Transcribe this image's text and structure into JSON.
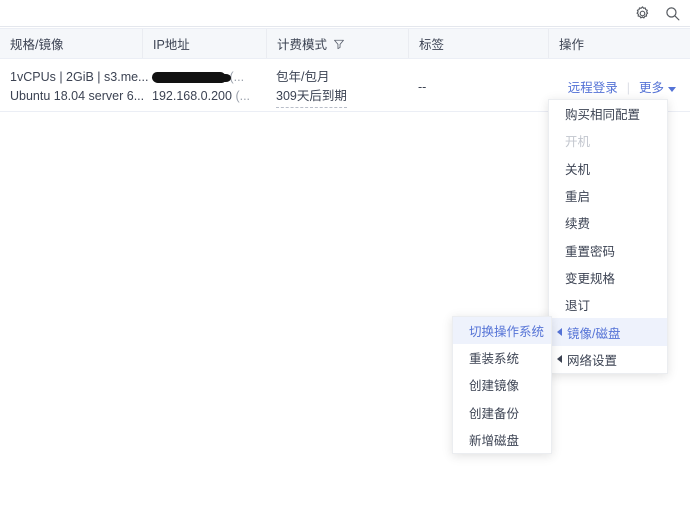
{
  "toolbar": {
    "icons": [
      {
        "name": "gear-icon",
        "label": "设置"
      },
      {
        "name": "search-icon",
        "label": "搜索"
      }
    ]
  },
  "table": {
    "headers": [
      {
        "label": "规格/镜像",
        "filter": false
      },
      {
        "label": "IP地址",
        "filter": false
      },
      {
        "label": "计费模式",
        "filter": true
      },
      {
        "label": "标签",
        "filter": false
      },
      {
        "label": "操作",
        "filter": false
      }
    ],
    "rows": [
      {
        "spec_line1": "1vCPUs | 2GiB | s3.me...",
        "spec_line2": "Ubuntu 18.04 server 6...",
        "ip_line1_tail": "(...",
        "ip_line2": "192.168.0.200",
        "ip_line2_tail": "(...",
        "billing_line1": "包年/包月",
        "billing_line2": "309天后到期",
        "tag": "--",
        "action_login": "远程登录",
        "action_more": "更多"
      }
    ]
  },
  "menu": {
    "items": [
      {
        "label": "购买相同配置",
        "disabled": false,
        "active": false,
        "submenu": false
      },
      {
        "label": "开机",
        "disabled": true,
        "active": false,
        "submenu": false
      },
      {
        "label": "关机",
        "disabled": false,
        "active": false,
        "submenu": false
      },
      {
        "label": "重启",
        "disabled": false,
        "active": false,
        "submenu": false
      },
      {
        "label": "续费",
        "disabled": false,
        "active": false,
        "submenu": false
      },
      {
        "label": "重置密码",
        "disabled": false,
        "active": false,
        "submenu": false
      },
      {
        "label": "变更规格",
        "disabled": false,
        "active": false,
        "submenu": false
      },
      {
        "label": "退订",
        "disabled": false,
        "active": false,
        "submenu": false
      },
      {
        "label": "镜像/磁盘",
        "disabled": false,
        "active": true,
        "submenu": true
      },
      {
        "label": "网络设置",
        "disabled": false,
        "active": false,
        "submenu": true
      }
    ]
  },
  "submenu": {
    "items": [
      {
        "label": "切换操作系统",
        "active": true
      },
      {
        "label": "重装系统",
        "active": false
      },
      {
        "label": "创建镜像",
        "active": false
      },
      {
        "label": "创建备份",
        "active": false
      },
      {
        "label": "新增磁盘",
        "active": false
      }
    ]
  },
  "colors": {
    "link": "#5573d6",
    "header_bg": "#f5f7fa",
    "active_bg": "#eef2fc",
    "text": "#3c4353",
    "disabled": "#c2c6ce"
  }
}
